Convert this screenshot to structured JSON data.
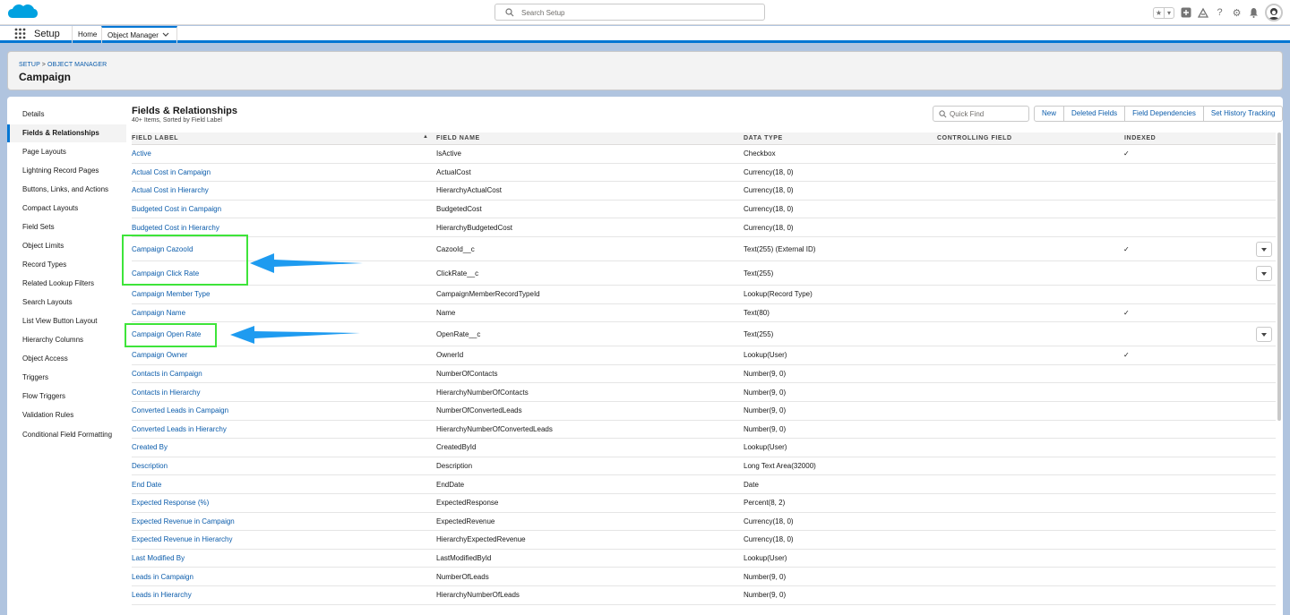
{
  "header": {
    "search_placeholder": "Search Setup"
  },
  "nav": {
    "app_name": "Setup",
    "home": "Home",
    "object_manager": "Object Manager"
  },
  "page": {
    "breadcrumb_setup": "SETUP",
    "breadcrumb_sep": ">",
    "breadcrumb_om": "OBJECT MANAGER",
    "title": "Campaign"
  },
  "sidebar": {
    "items": [
      {
        "label": "Details"
      },
      {
        "label": "Fields & Relationships"
      },
      {
        "label": "Page Layouts"
      },
      {
        "label": "Lightning Record Pages"
      },
      {
        "label": "Buttons, Links, and Actions"
      },
      {
        "label": "Compact Layouts"
      },
      {
        "label": "Field Sets"
      },
      {
        "label": "Object Limits"
      },
      {
        "label": "Record Types"
      },
      {
        "label": "Related Lookup Filters"
      },
      {
        "label": "Search Layouts"
      },
      {
        "label": "List View Button Layout"
      },
      {
        "label": "Hierarchy Columns"
      },
      {
        "label": "Object Access"
      },
      {
        "label": "Triggers"
      },
      {
        "label": "Flow Triggers"
      },
      {
        "label": "Validation Rules"
      },
      {
        "label": "Conditional Field Formatting"
      }
    ],
    "active_index": 1
  },
  "content": {
    "title": "Fields & Relationships",
    "subtitle": "40+ Items, Sorted by Field Label",
    "quick_find_placeholder": "Quick Find",
    "buttons": {
      "new": "New",
      "deleted_fields": "Deleted Fields",
      "field_dependencies": "Field Dependencies",
      "set_history_tracking": "Set History Tracking"
    },
    "columns": {
      "field_label": "FIELD LABEL",
      "field_name": "FIELD NAME",
      "data_type": "DATA TYPE",
      "controlling_field": "CONTROLLING FIELD",
      "indexed": "INDEXED"
    },
    "sort_indicator": "▲",
    "check_glyph": "✓",
    "rows": [
      {
        "label": "Active",
        "name": "IsActive",
        "type": "Checkbox",
        "indexed": true,
        "menu": false
      },
      {
        "label": "Actual Cost in Campaign",
        "name": "ActualCost",
        "type": "Currency(18, 0)",
        "indexed": false,
        "menu": false
      },
      {
        "label": "Actual Cost in Hierarchy",
        "name": "HierarchyActualCost",
        "type": "Currency(18, 0)",
        "indexed": false,
        "menu": false
      },
      {
        "label": "Budgeted Cost in Campaign",
        "name": "BudgetedCost",
        "type": "Currency(18, 0)",
        "indexed": false,
        "menu": false
      },
      {
        "label": "Budgeted Cost in Hierarchy",
        "name": "HierarchyBudgetedCost",
        "type": "Currency(18, 0)",
        "indexed": false,
        "menu": false
      },
      {
        "label": "Campaign CazooId",
        "name": "CazooId__c",
        "type": "Text(255) (External ID)",
        "indexed": true,
        "menu": true
      },
      {
        "label": "Campaign Click Rate",
        "name": "ClickRate__c",
        "type": "Text(255)",
        "indexed": false,
        "menu": true
      },
      {
        "label": "Campaign Member Type",
        "name": "CampaignMemberRecordTypeId",
        "type": "Lookup(Record Type)",
        "indexed": false,
        "menu": false
      },
      {
        "label": "Campaign Name",
        "name": "Name",
        "type": "Text(80)",
        "indexed": true,
        "menu": false
      },
      {
        "label": "Campaign Open Rate",
        "name": "OpenRate__c",
        "type": "Text(255)",
        "indexed": false,
        "menu": true
      },
      {
        "label": "Campaign Owner",
        "name": "OwnerId",
        "type": "Lookup(User)",
        "indexed": true,
        "menu": false
      },
      {
        "label": "Contacts in Campaign",
        "name": "NumberOfContacts",
        "type": "Number(9, 0)",
        "indexed": false,
        "menu": false
      },
      {
        "label": "Contacts in Hierarchy",
        "name": "HierarchyNumberOfContacts",
        "type": "Number(9, 0)",
        "indexed": false,
        "menu": false
      },
      {
        "label": "Converted Leads in Campaign",
        "name": "NumberOfConvertedLeads",
        "type": "Number(9, 0)",
        "indexed": false,
        "menu": false
      },
      {
        "label": "Converted Leads in Hierarchy",
        "name": "HierarchyNumberOfConvertedLeads",
        "type": "Number(9, 0)",
        "indexed": false,
        "menu": false
      },
      {
        "label": "Created By",
        "name": "CreatedById",
        "type": "Lookup(User)",
        "indexed": false,
        "menu": false
      },
      {
        "label": "Description",
        "name": "Description",
        "type": "Long Text Area(32000)",
        "indexed": false,
        "menu": false
      },
      {
        "label": "End Date",
        "name": "EndDate",
        "type": "Date",
        "indexed": false,
        "menu": false
      },
      {
        "label": "Expected Response (%)",
        "name": "ExpectedResponse",
        "type": "Percent(8, 2)",
        "indexed": false,
        "menu": false
      },
      {
        "label": "Expected Revenue in Campaign",
        "name": "ExpectedRevenue",
        "type": "Currency(18, 0)",
        "indexed": false,
        "menu": false
      },
      {
        "label": "Expected Revenue in Hierarchy",
        "name": "HierarchyExpectedRevenue",
        "type": "Currency(18, 0)",
        "indexed": false,
        "menu": false
      },
      {
        "label": "Last Modified By",
        "name": "LastModifiedById",
        "type": "Lookup(User)",
        "indexed": false,
        "menu": false
      },
      {
        "label": "Leads in Campaign",
        "name": "NumberOfLeads",
        "type": "Number(9, 0)",
        "indexed": false,
        "menu": false
      },
      {
        "label": "Leads in Hierarchy",
        "name": "HierarchyNumberOfLeads",
        "type": "Number(9, 0)",
        "indexed": false,
        "menu": false
      }
    ]
  },
  "colors": {
    "link": "#0b5cab",
    "brand": "#0176d3",
    "highlight_box": "#3ee43a",
    "arrow": "#1e9bf0",
    "background": "#b0c4df"
  },
  "icons": {
    "logo": "salesforce-cloud-logo",
    "search": "search-icon",
    "favorites": "star-icon",
    "add": "plus-icon",
    "trailhead": "trailhead-icon",
    "help": "question-icon",
    "settings": "gear-icon",
    "notifications": "bell-icon"
  }
}
